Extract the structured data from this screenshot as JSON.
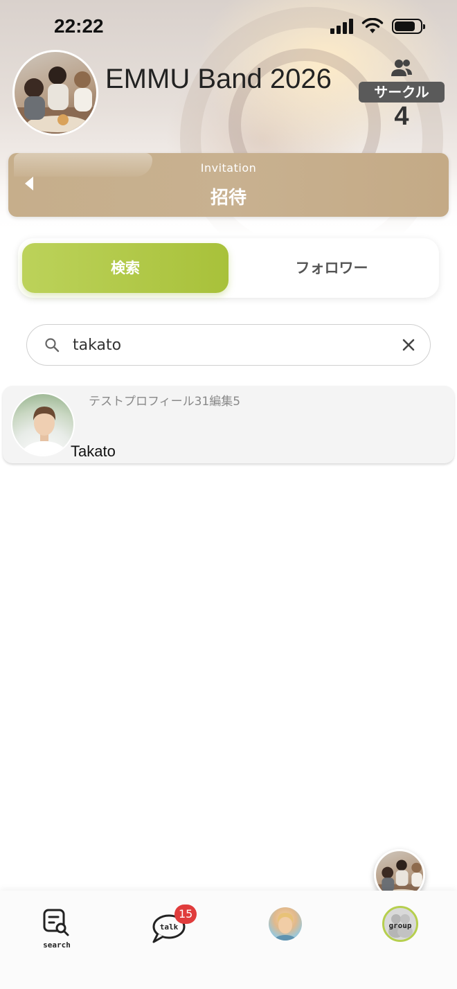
{
  "status_bar": {
    "time": "22:22"
  },
  "header": {
    "group_name": "EMMU Band 2026",
    "members_label": "サークル",
    "members_count": "4"
  },
  "invite_bar": {
    "subtitle": "Invitation",
    "title": "招待"
  },
  "segment": {
    "active_label": "検索",
    "inactive_label": "フォロワー"
  },
  "search": {
    "value": "takato"
  },
  "results": [
    {
      "bio": "テストプロフィール31編集5",
      "name": "Takato"
    }
  ],
  "tab_bar": {
    "search_label": "search",
    "talk_label": "talk",
    "talk_badge": "15",
    "group_label": "group"
  },
  "colors": {
    "accent_green": "#a8c13a",
    "invite_tan": "#c6ae8b",
    "badge_red": "#e03c3c"
  }
}
